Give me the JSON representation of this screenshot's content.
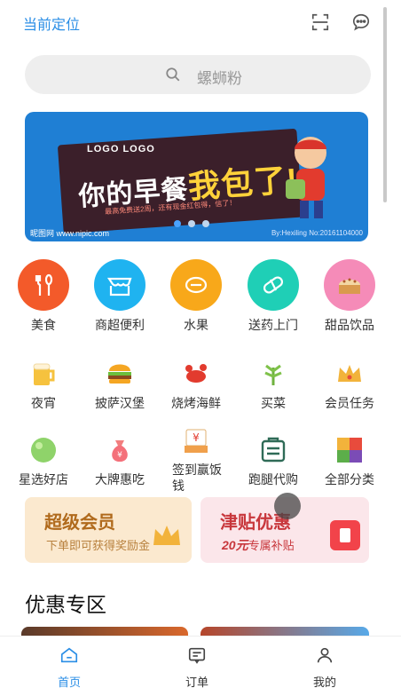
{
  "header": {
    "location_label": "当前定位",
    "scan_icon": "scan-icon",
    "message_icon": "message-icon"
  },
  "search": {
    "placeholder": "螺蛳粉",
    "icon": "search-icon"
  },
  "banner": {
    "logo_text": "LOGO   LOGO",
    "slogan_main": "你的早餐",
    "slogan_emph": "我包了!",
    "subtext": "最高免费送2周，还有现金红包得，信了！",
    "watermark": "昵图网 www.nipic.com",
    "watermark_right": "By:Hexiling No:20161104000",
    "dots": 3,
    "active_dot": 0
  },
  "categories_primary": [
    {
      "label": "美食",
      "icon": "fork-knife-icon",
      "color": "#f35a2a"
    },
    {
      "label": "商超便利",
      "icon": "store-icon",
      "color": "#1fb3f0"
    },
    {
      "label": "水果",
      "icon": "lemon-icon",
      "color": "#f8a81a"
    },
    {
      "label": "送药上门",
      "icon": "pill-icon",
      "color": "#1fcfb6"
    },
    {
      "label": "甜品饮品",
      "icon": "cake-icon",
      "color": "#f58bb8"
    }
  ],
  "categories_secondary_1": [
    {
      "label": "夜宵",
      "icon": "beer-icon"
    },
    {
      "label": "披萨汉堡",
      "icon": "burger-icon"
    },
    {
      "label": "烧烤海鲜",
      "icon": "lobster-icon"
    },
    {
      "label": "买菜",
      "icon": "vegetable-icon"
    },
    {
      "label": "会员任务",
      "icon": "crown-icon"
    }
  ],
  "categories_secondary_2": [
    {
      "label": "星选好店",
      "icon": "star-shop-icon"
    },
    {
      "label": "大牌惠吃",
      "icon": "money-bag-icon"
    },
    {
      "label": "签到赢饭钱",
      "icon": "checkin-icon"
    },
    {
      "label": "跑腿代购",
      "icon": "errand-icon"
    },
    {
      "label": "全部分类",
      "icon": "all-categories-icon"
    }
  ],
  "promos": {
    "vip_title": "超级会员",
    "vip_sub": "下单即可获得奖励金",
    "subsidy_title": "津贴优惠",
    "subsidy_amount": "20元",
    "subsidy_sub": "专属补贴"
  },
  "section": {
    "title": "优惠专区"
  },
  "tabbar": [
    {
      "label": "首页",
      "icon": "home-icon",
      "active": true
    },
    {
      "label": "订单",
      "icon": "order-icon",
      "active": false
    },
    {
      "label": "我的",
      "icon": "profile-icon",
      "active": false
    }
  ],
  "colors": {
    "accent": "#2a8ee6",
    "banner_bg": "#1f7fd4",
    "vip_bg": "#fbe9cf",
    "subsidy_bg": "#fbe6ea"
  }
}
